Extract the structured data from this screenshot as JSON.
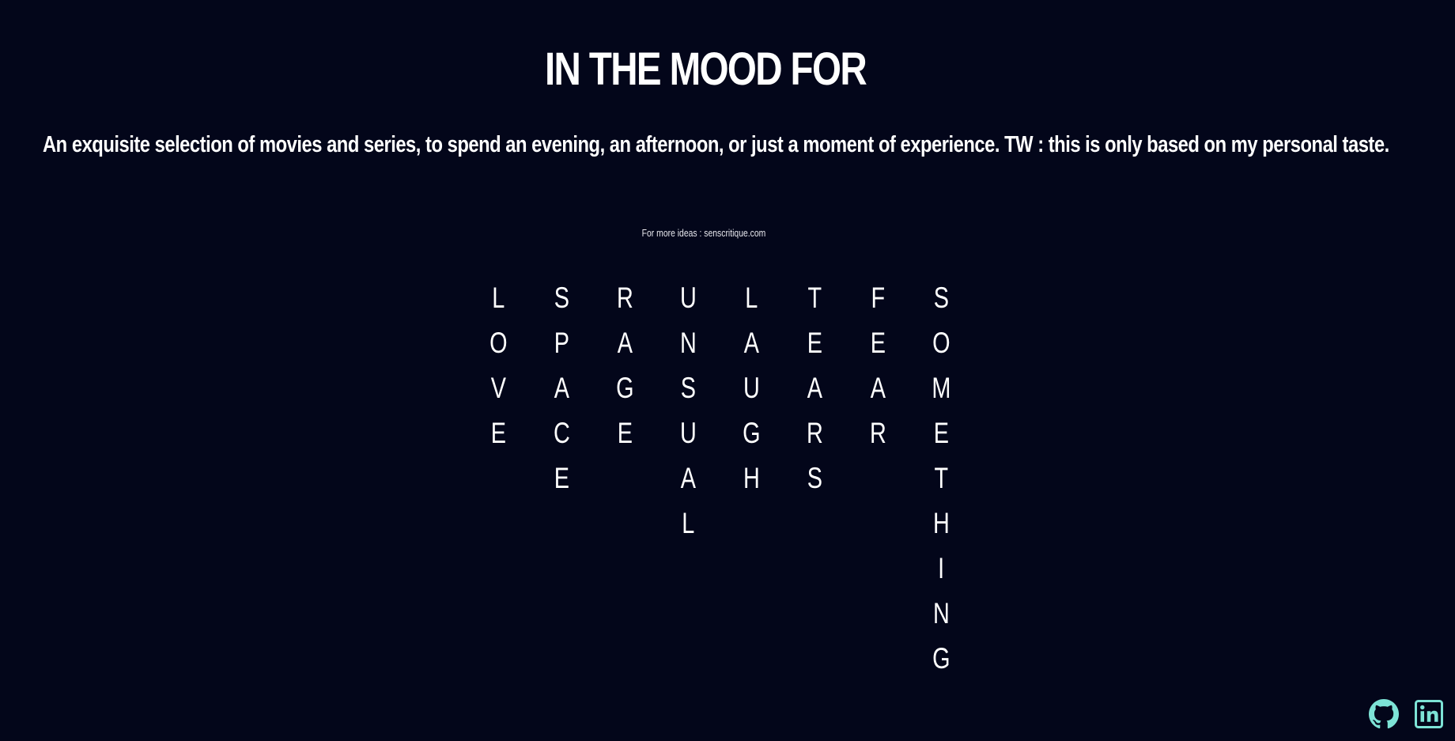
{
  "header": {
    "title": "IN THE MOOD FOR",
    "description": "An exquisite selection of movies and series, to spend an evening, an afternoon, or just a moment of experience. TW : this is only based on my personal taste."
  },
  "more_ideas": {
    "prefix": "For more ideas : ",
    "link_label": "senscritique.com"
  },
  "moods": [
    {
      "name": "LOVE",
      "letters": [
        "L",
        "O",
        "V",
        "E"
      ]
    },
    {
      "name": "SPACE",
      "letters": [
        "S",
        "P",
        "A",
        "C",
        "E"
      ]
    },
    {
      "name": "RAGE",
      "letters": [
        "R",
        "A",
        "G",
        "E"
      ]
    },
    {
      "name": "UNUSUAL",
      "letters": [
        "U",
        "N",
        "S",
        "U",
        "A",
        "L"
      ]
    },
    {
      "name": "LAUGHS",
      "letters": [
        "L",
        "A",
        "U",
        "G",
        "H"
      ]
    },
    {
      "name": "TEARS",
      "letters": [
        "T",
        "E",
        "A",
        "R",
        "S"
      ]
    },
    {
      "name": "FEAR",
      "letters": [
        "F",
        "E",
        "A",
        "R"
      ]
    },
    {
      "name": "SOMETHING",
      "letters": [
        "S",
        "O",
        "M",
        "E",
        "T",
        "H",
        "I",
        "N",
        "G"
      ]
    }
  ],
  "footer": {
    "icons": [
      "github-icon",
      "linkedin-icon"
    ],
    "icon_color": "#7de3d6"
  },
  "colors": {
    "background": "#03061a",
    "text": "#ffffff"
  }
}
